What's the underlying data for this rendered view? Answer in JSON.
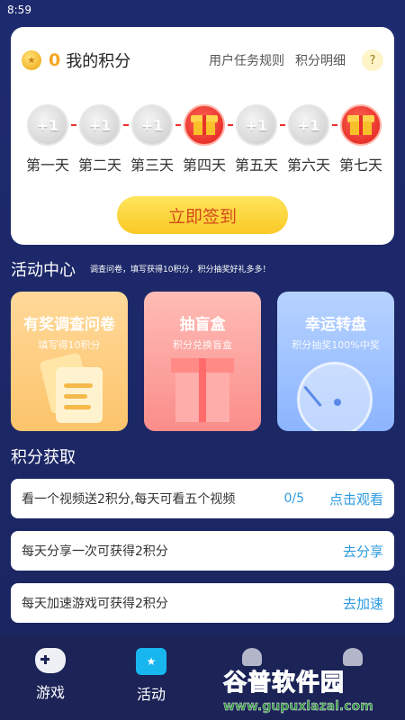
{
  "status_bar": {
    "time": "8:59"
  },
  "points": {
    "value": "0",
    "title": "我的积分",
    "rules_link": "用户任务规则",
    "detail_link": "积分明细",
    "help": "?"
  },
  "checkin": {
    "days": [
      {
        "reward": "+1",
        "label": "第一天",
        "type": "coin"
      },
      {
        "reward": "+1",
        "label": "第二天",
        "type": "coin"
      },
      {
        "reward": "+1",
        "label": "第三天",
        "type": "coin"
      },
      {
        "reward": "",
        "label": "第四天",
        "type": "gift"
      },
      {
        "reward": "+1",
        "label": "第五天",
        "type": "coin"
      },
      {
        "reward": "+1",
        "label": "第六天",
        "type": "coin"
      },
      {
        "reward": "",
        "label": "第七天",
        "type": "gift"
      }
    ],
    "button_label": "立即签到"
  },
  "activity": {
    "title": "活动中心",
    "subtitle": "调查问卷，填写获得10积分，积分抽奖好礼多多！",
    "cards": [
      {
        "title": "有奖调查问卷",
        "sub": "填写得10积分"
      },
      {
        "title": "抽盲盒",
        "sub": "积分兑换盲盒"
      },
      {
        "title": "幸运转盘",
        "sub": "积分抽奖100%中奖"
      }
    ]
  },
  "earn": {
    "title": "积分获取",
    "tasks": [
      {
        "text": "看一个视频送2积分,每天可看五个视频",
        "count": "0/5",
        "action": "点击观看"
      },
      {
        "text": "每天分享一次可获得2积分",
        "count": "",
        "action": "去分享"
      },
      {
        "text": "每天加速游戏可获得2积分",
        "count": "",
        "action": "去加速"
      }
    ]
  },
  "nav": {
    "items": [
      {
        "label": "游戏"
      },
      {
        "label": "活动"
      }
    ]
  },
  "watermark": {
    "logo": "谷普软件园",
    "url": "www.gupuxlazal.com"
  },
  "colors": {
    "accent": "#2d9be0",
    "gift_red": "#e8312a",
    "button_yellow": "#f9c926",
    "background": "#1d2a6e"
  }
}
